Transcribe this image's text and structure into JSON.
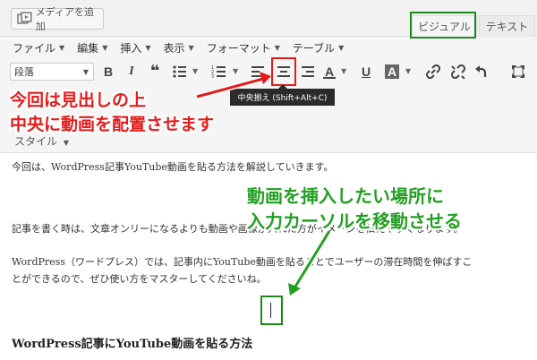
{
  "toolbar_top": {
    "media_button_label": "メディアを追加",
    "tabs": {
      "visual": "ビジュアル",
      "text": "テキスト"
    }
  },
  "menubar": {
    "items": [
      "ファイル",
      "編集",
      "挿入",
      "表示",
      "フォーマット",
      "テーブル"
    ]
  },
  "format_toolbar": {
    "format_select": "段落",
    "style_select": "スタイル",
    "tooltip": "中央揃え (Shift+Alt+C)",
    "buttons": [
      "bold",
      "italic",
      "blockquote",
      "bullet-list",
      "numbered-list",
      "align-left",
      "align-center",
      "align-right",
      "text-color",
      "underline",
      "background-color",
      "insert-link",
      "remove-link",
      "undo",
      "fullscreen"
    ]
  },
  "content": {
    "para1": "今回は、WordPress記事YouTube動画を貼る方法を解説していきます。",
    "para2": "記事を書く時は、文章オンリーになるよりも動画や画像が入れた方がイメージを伝えやすくなります。",
    "para3_line1": "WordPress（ワードプレス）では、記事内にYouTube動画を貼ることでユーザーの滞在時間を伸ばすこ",
    "para3_line2": "とができるので、ぜひ使い方をマスターしてくださいね。",
    "heading": "WordPress記事にYouTube動画を貼る方法"
  },
  "annotations": {
    "red_line1": "今回は見出しの上",
    "red_line2": "中央に動画を配置させます",
    "green_line1": "動画を挿入したい場所に",
    "green_line2": "入力カーソルを移動させる"
  },
  "colors": {
    "annotation_red": "#e51b1b",
    "annotation_green": "#22a022",
    "tooltip_bg": "#2b2b2b"
  }
}
